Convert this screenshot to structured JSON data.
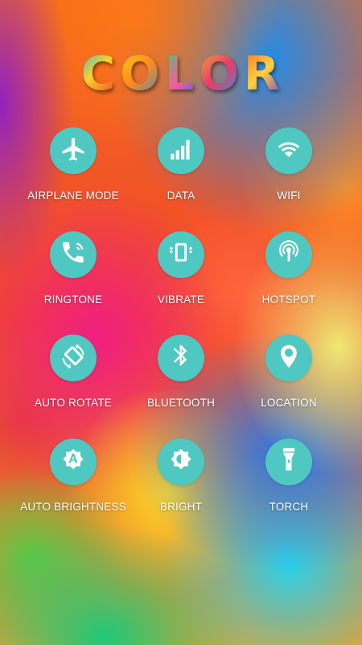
{
  "logo": {
    "letters": [
      "C",
      "O",
      "L",
      "O",
      "R"
    ]
  },
  "colors": {
    "tile_circle": "#4fc8c2",
    "label_text": "#ffffff"
  },
  "toggles": [
    {
      "label": "AIRPLANE MODE",
      "icon": "airplane-icon"
    },
    {
      "label": "DATA",
      "icon": "signal-bars-icon"
    },
    {
      "label": "WIFI",
      "icon": "wifi-icon"
    },
    {
      "label": "RINGTONE",
      "icon": "phone-ring-icon"
    },
    {
      "label": "VIBRATE",
      "icon": "vibrate-icon"
    },
    {
      "label": "HOTSPOT",
      "icon": "hotspot-icon"
    },
    {
      "label": "AUTO ROTATE",
      "icon": "rotate-icon"
    },
    {
      "label": "BLUETOOTH",
      "icon": "bluetooth-icon"
    },
    {
      "label": "LOCATION",
      "icon": "location-pin-icon"
    },
    {
      "label": "AUTO BRIGHTNESS",
      "icon": "auto-brightness-icon"
    },
    {
      "label": "BRIGHT",
      "icon": "brightness-icon"
    },
    {
      "label": "TORCH",
      "icon": "torch-icon"
    }
  ]
}
